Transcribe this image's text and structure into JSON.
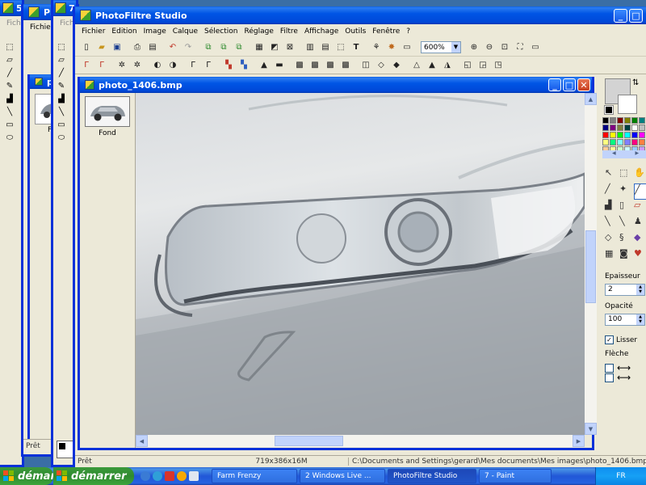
{
  "background_windows": [
    {
      "title": "5",
      "menu": "Fichie"
    },
    {
      "title": "Phot",
      "menu": "Fichier"
    },
    {
      "title": "7",
      "menu": "Fichie"
    }
  ],
  "app": {
    "title": "PhotoFiltre Studio",
    "menus": [
      "Fichier",
      "Edition",
      "Image",
      "Calque",
      "Sélection",
      "Réglage",
      "Filtre",
      "Affichage",
      "Outils",
      "Fenêtre",
      "?"
    ],
    "zoom": "600%",
    "status_left": "Prêt",
    "status_size": "719x386x16M",
    "status_path": "C:\\Documents and Settings\\gerard\\Mes documents\\Mes images\\photo_1406.bmp"
  },
  "doc": {
    "title": "photo_1406.bmp",
    "layer_label": "Fond"
  },
  "bg_doc": {
    "title": "photo",
    "layer_label": "Fo"
  },
  "palette": {
    "epaisseur_label": "Epaisseur",
    "epaisseur_value": "2",
    "opacite_label": "Opacité",
    "opacite_value": "100",
    "lisser_label": "Lisser",
    "fleche_label": "Flèche",
    "colors": [
      "#000000",
      "#808080",
      "#800000",
      "#808000",
      "#008000",
      "#008080",
      "#000080",
      "#800080",
      "#808040",
      "#004040",
      "#ffffff",
      "#c0c0c0",
      "#ff0000",
      "#ffff00",
      "#00ff00",
      "#00ffff",
      "#0000ff",
      "#ff00ff",
      "#ffff80",
      "#00ff80",
      "#80ffff",
      "#8080ff",
      "#ff0080",
      "#ff8040",
      "#ffcc99",
      "#ffff99",
      "#ccffcc",
      "#ccffff",
      "#99ccff",
      "#cc99ff"
    ]
  },
  "bg_status": "Prêt",
  "taskbar": {
    "start1": "démar",
    "start2": "démarrer",
    "buttons": [
      "Farm Frenzy",
      "2 Windows Live ...",
      "PhotoFiltre Studio",
      "7 - Paint"
    ],
    "tray_text": "FR"
  }
}
